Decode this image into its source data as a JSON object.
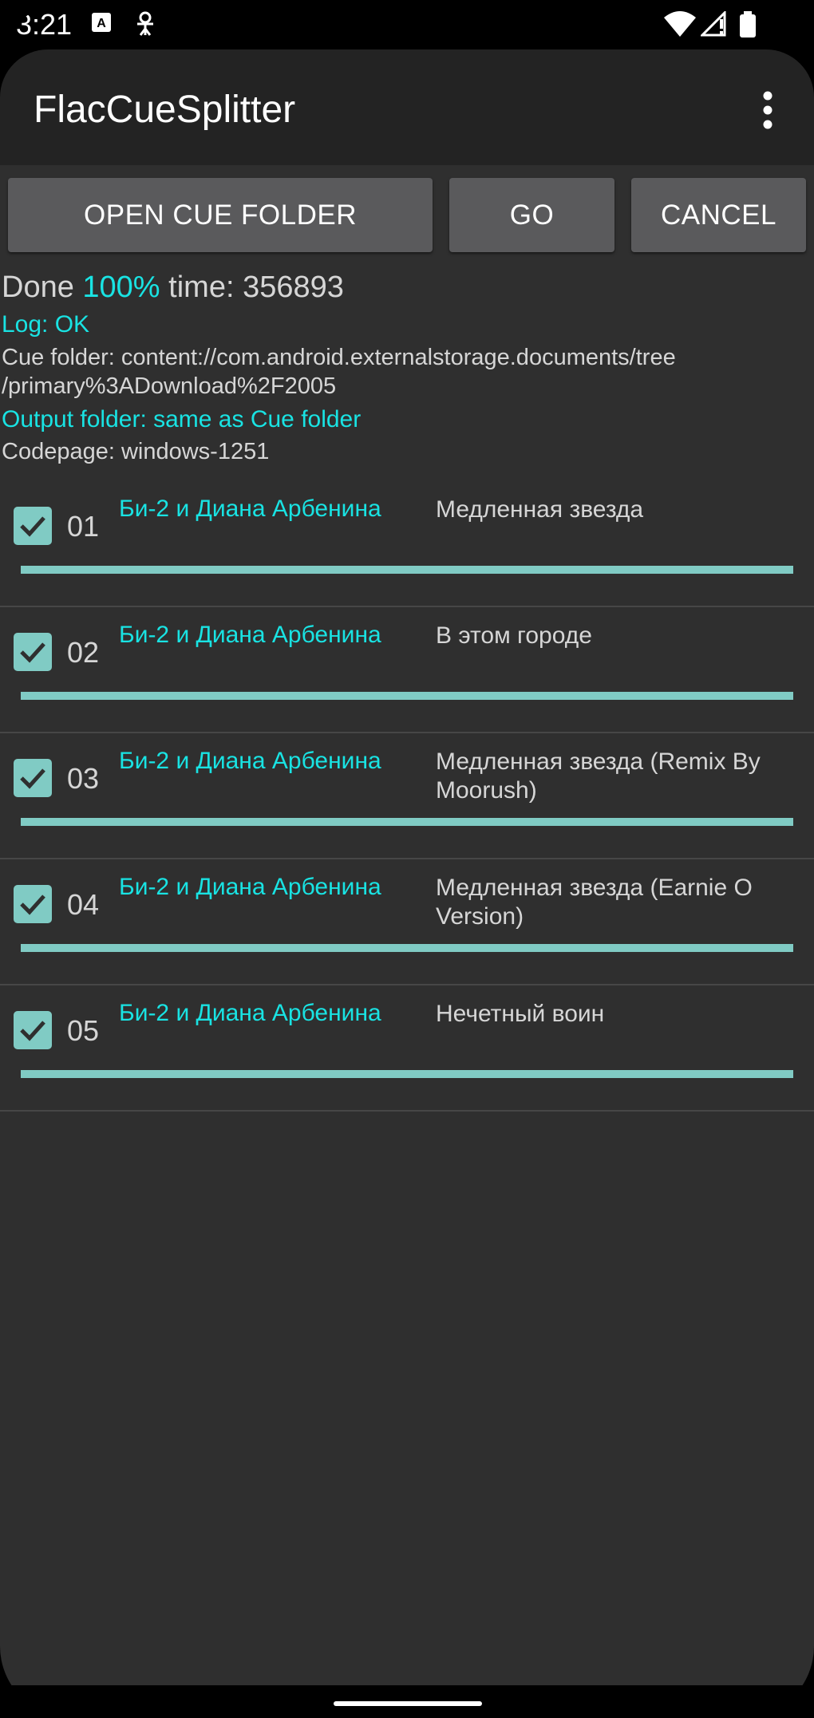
{
  "status_bar": {
    "time": "3:21"
  },
  "app_bar": {
    "title": "FlacCueSplitter"
  },
  "buttons": {
    "open_cue_folder": "OPEN CUE FOLDER",
    "go": "GO",
    "cancel": "CANCEL"
  },
  "progress": {
    "done_label": "Done",
    "percent_text": "100%",
    "time_label": "time:",
    "time_value": "356893"
  },
  "log": "Log: OK",
  "cue_folder": {
    "line1": "Cue folder: content://com.android.externalstorage.documents/tree",
    "line2": "/primary%3ADownload%2F2005"
  },
  "output_folder": "Output folder: same as Cue folder",
  "codepage": "Codepage: windows-1251",
  "tracks": [
    {
      "num": "01",
      "artist": "Би-2 и Диана Арбенина",
      "title": "Медленная звезда",
      "checked": true,
      "progress": 1.0
    },
    {
      "num": "02",
      "artist": "Би-2 и Диана Арбенина",
      "title": "В этом городе",
      "checked": true,
      "progress": 1.0
    },
    {
      "num": "03",
      "artist": "Би-2 и Диана Арбенина",
      "title": "Медленная звезда (Remix By Moorush)",
      "checked": true,
      "progress": 1.0
    },
    {
      "num": "04",
      "artist": "Би-2 и Диана Арбенина",
      "title": "Медленная звезда (Earnie O Version)",
      "checked": true,
      "progress": 1.0
    },
    {
      "num": "05",
      "artist": "Би-2 и Диана Арбенина",
      "title": "Нечетный воин",
      "checked": true,
      "progress": 1.0
    }
  ],
  "colors": {
    "accent": "#19e3e3",
    "checkbox": "#80cbc4",
    "background": "#2f2f2f",
    "appbar": "#232323",
    "button": "#5a5a5c"
  }
}
